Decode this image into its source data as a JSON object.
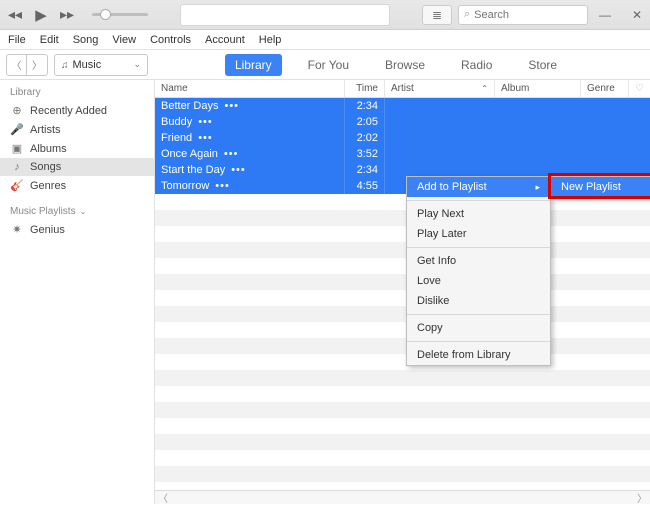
{
  "menubar": [
    "File",
    "Edit",
    "Song",
    "View",
    "Controls",
    "Account",
    "Help"
  ],
  "search": {
    "placeholder": "Search"
  },
  "source_select": {
    "label": "Music"
  },
  "tabs": [
    "Library",
    "For You",
    "Browse",
    "Radio",
    "Store"
  ],
  "active_tab": 0,
  "sidebar": {
    "library_header": "Library",
    "items": [
      {
        "icon": "⊕",
        "label": "Recently Added"
      },
      {
        "icon": "🎤",
        "label": "Artists"
      },
      {
        "icon": "▣",
        "label": "Albums"
      },
      {
        "icon": "♪",
        "label": "Songs"
      },
      {
        "icon": "🎸",
        "label": "Genres"
      }
    ],
    "active_index": 3,
    "playlists_header": "Music Playlists",
    "playlists": [
      {
        "icon": "✷",
        "label": "Genius"
      }
    ]
  },
  "columns": {
    "name": "Name",
    "time": "Time",
    "artist": "Artist",
    "album": "Album",
    "genre": "Genre"
  },
  "songs": [
    {
      "name": "Better Days",
      "time": "2:34"
    },
    {
      "name": "Buddy",
      "time": "2:05"
    },
    {
      "name": "Friend",
      "time": "2:02"
    },
    {
      "name": "Once Again",
      "time": "3:52"
    },
    {
      "name": "Start the Day",
      "time": "2:34"
    },
    {
      "name": "Tomorrow",
      "time": "4:55"
    }
  ],
  "context_menu": {
    "add_to_playlist": "Add to Playlist",
    "play_next": "Play Next",
    "play_later": "Play Later",
    "get_info": "Get Info",
    "love": "Love",
    "dislike": "Dislike",
    "copy": "Copy",
    "delete": "Delete from Library"
  },
  "submenu": {
    "new_playlist": "New Playlist"
  }
}
